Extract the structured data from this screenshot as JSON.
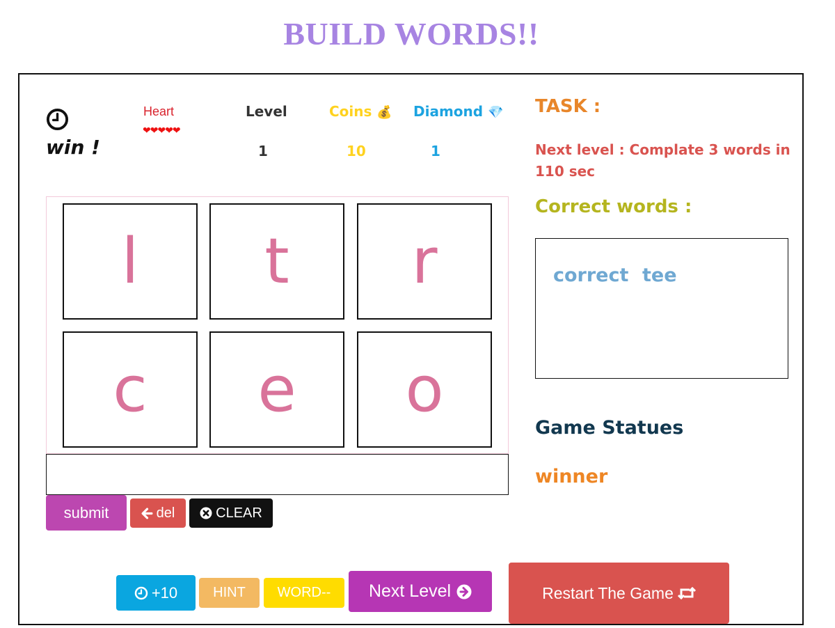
{
  "header": {
    "title": "BUILD WORDS!!"
  },
  "status_bar": {
    "timer_text": "win !",
    "heart_label": "Heart",
    "hearts": "❤❤❤❤❤",
    "level_label": "Level",
    "level_value": "1",
    "coins_label": "Coins",
    "coins_icon": "💰",
    "coins_value": "10",
    "diamond_label": "Diamond",
    "diamond_icon": "💎",
    "diamond_value": "1"
  },
  "task": {
    "title": "TASK :",
    "text": "Next level : Complate 3 words in 110 sec"
  },
  "correct_words": {
    "title": "Correct words :",
    "words": [
      "correct",
      "tee"
    ]
  },
  "game_status": {
    "title": "Game Statues",
    "value": "winner"
  },
  "letters": [
    "l",
    "t",
    "r",
    "c",
    "e",
    "o"
  ],
  "answer_input": {
    "value": ""
  },
  "controls": {
    "submit_label": "submit",
    "del_label": "del",
    "clear_label": "CLEAR"
  },
  "bottom_buttons": {
    "time_label": "+10",
    "hint_label": "HINT",
    "word_label": "WORD--",
    "next_label": "Next Level",
    "restart_label": "Restart The Game"
  },
  "colors": {
    "title": "#a784e2",
    "tile_letter": "#d9739a",
    "submit": "#bc47b0",
    "danger": "#d9534f",
    "info": "#0aa6e0",
    "hint": "#f3b962",
    "word": "#ffdc00",
    "next": "#b636b4"
  }
}
